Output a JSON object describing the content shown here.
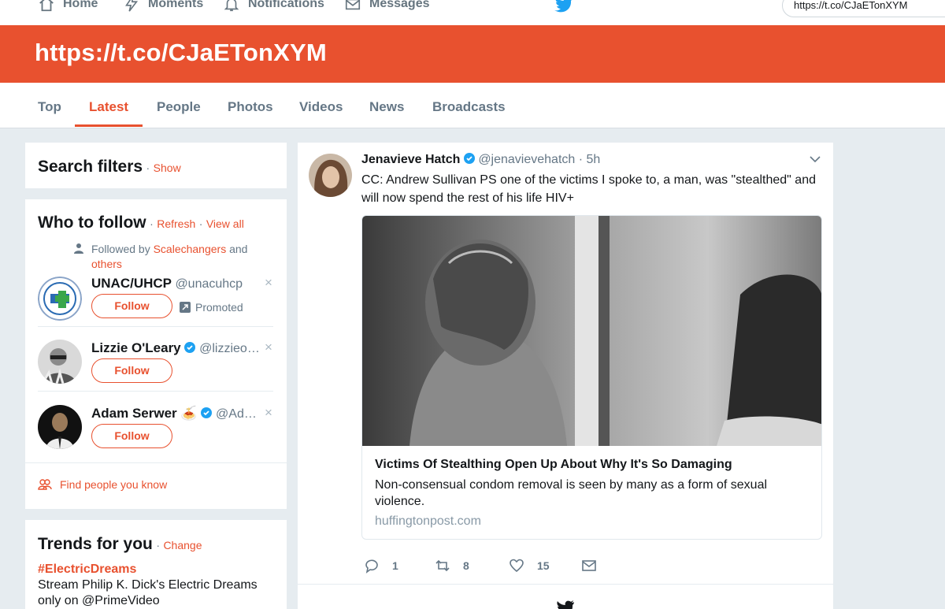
{
  "topnav": {
    "items": [
      {
        "label": "Home",
        "icon": "home-icon"
      },
      {
        "label": "Moments",
        "icon": "lightning-icon"
      },
      {
        "label": "Notifications",
        "icon": "bell-icon"
      },
      {
        "label": "Messages",
        "icon": "envelope-icon"
      }
    ],
    "search_value": "https://t.co/CJaETonXYM"
  },
  "banner": {
    "title": "https://t.co/CJaETonXYM"
  },
  "tabs": [
    "Top",
    "Latest",
    "People",
    "Photos",
    "Videos",
    "News",
    "Broadcasts"
  ],
  "active_tab": "Latest",
  "search_filters": {
    "title": "Search filters",
    "sep": "·",
    "show_label": "Show"
  },
  "who_to_follow": {
    "title": "Who to follow",
    "sep": "·",
    "refresh_label": "Refresh",
    "view_all_label": "View all",
    "followed_by_prefix": "Followed by",
    "followed_by_name": "Scalechangers",
    "followed_by_and": "and",
    "followed_by_others": "others",
    "follow_label": "Follow",
    "accounts": [
      {
        "name": "UNAC/UHCP",
        "handle": "@unacuhcp",
        "promoted": "Promoted"
      },
      {
        "name": "Lizzie O'Leary",
        "handle": "@lizzieo…",
        "verified": true
      },
      {
        "name": "Adam Serwer",
        "handle": "@Ad…",
        "verified": true,
        "emoji": "🍝"
      }
    ],
    "find_people_label": "Find people you know"
  },
  "trends": {
    "title": "Trends for you",
    "sep": "·",
    "change_label": "Change",
    "items": [
      {
        "tag": "#ElectricDreams",
        "desc": "Stream Philip K. Dick's Electric Dreams only on @PrimeVideo"
      }
    ]
  },
  "tweet": {
    "name": "Jenavieve Hatch",
    "handle": "@jenavievehatch",
    "sep": "·",
    "time": "5h",
    "text": "CC: Andrew Sullivan PS one of the victims I spoke to, a man, was \"stealthed\" and will now spend the rest of his life HIV+",
    "card": {
      "title": "Victims Of Stealthing Open Up About Why It's So Damaging",
      "description": "Non-consensual condom removal is seen by many as a form of sexual violence.",
      "domain": "huffingtonpost.com"
    },
    "replies": "1",
    "retweets": "8",
    "likes": "15"
  },
  "colors": {
    "accent": "#e8512f",
    "verified": "#1da1f2",
    "text_secondary": "#657786"
  }
}
